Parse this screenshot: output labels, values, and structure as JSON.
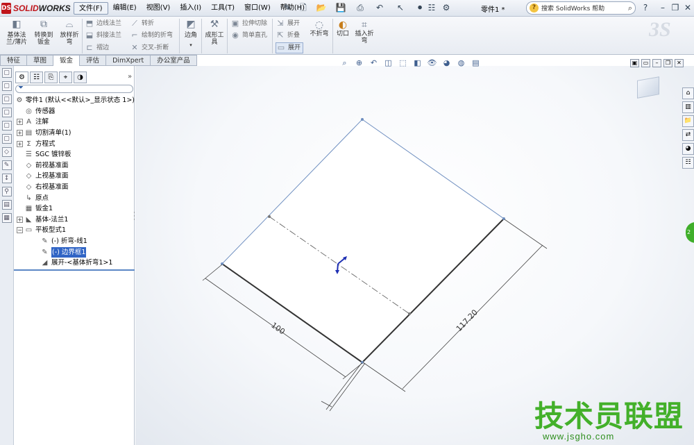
{
  "app": {
    "logo_prefix": "SOLID",
    "logo_suffix": "WORKS",
    "doc_title": "零件1 *"
  },
  "menu": [
    "文件(F)",
    "编辑(E)",
    "视图(V)",
    "插入(I)",
    "工具(T)",
    "窗口(W)",
    "帮助(H)"
  ],
  "help_search": {
    "placeholder": "搜索 SolidWorks 帮助"
  },
  "commands": {
    "base_flange": "基体法\n兰/薄片",
    "convert_to_sheet": "转换到\n钣金",
    "lofted_bend": "放样折\n弯",
    "edge_flange": "边线法兰",
    "miter_flange": "斜接法兰",
    "hem": "褶边",
    "jog": "转折",
    "sketched_bend": "绘制的折弯",
    "cross_break": "交叉-折断",
    "corners": "边角",
    "forming_tool": "成形工\n具",
    "extruded_cut": "拉伸切除",
    "simple_hole": "简单直孔",
    "unfold": "展开",
    "fold": "折叠",
    "flatten": "展开",
    "no_bends": "不折弯",
    "rip": "切口",
    "insert_bends": "插入折\n弯"
  },
  "tabs": [
    "特征",
    "草图",
    "钣金",
    "评估",
    "DimXpert",
    "办公室产品"
  ],
  "active_tab": "钣金",
  "tree": {
    "root": "零件1  (默认<<默认>_显示状态 1>)",
    "items": [
      {
        "label": "传感器",
        "icon": "sensor-icon",
        "expandable": false,
        "indent": 1
      },
      {
        "label": "注解",
        "icon": "annotation-icon",
        "expandable": true,
        "indent": 1
      },
      {
        "label": "切割清单(1)",
        "icon": "cutlist-icon",
        "expandable": true,
        "indent": 1
      },
      {
        "label": "方程式",
        "icon": "equation-icon",
        "expandable": true,
        "indent": 1
      },
      {
        "label": "SGC 镀锌板",
        "icon": "material-icon",
        "expandable": false,
        "indent": 1
      },
      {
        "label": "前视基准面",
        "icon": "plane-icon",
        "expandable": false,
        "indent": 1
      },
      {
        "label": "上视基准面",
        "icon": "plane-icon",
        "expandable": false,
        "indent": 1
      },
      {
        "label": "右视基准面",
        "icon": "plane-icon",
        "expandable": false,
        "indent": 1
      },
      {
        "label": "原点",
        "icon": "origin-icon",
        "expandable": false,
        "indent": 1
      },
      {
        "label": "钣金1",
        "icon": "sheetmetal-icon",
        "expandable": false,
        "indent": 1
      },
      {
        "label": "基体-法兰1",
        "icon": "flange-icon",
        "expandable": true,
        "indent": 1
      },
      {
        "label": "平板型式1",
        "icon": "flatpattern-icon",
        "expandable": true,
        "expanded": true,
        "indent": 1
      },
      {
        "label": "(-) 折弯-线1",
        "icon": "sketch-icon",
        "expandable": false,
        "indent": 2
      },
      {
        "label": "(-) 边界框1",
        "icon": "sketch-icon",
        "expandable": false,
        "indent": 2,
        "selected": true
      },
      {
        "label": "展开-<基体折弯1>1",
        "icon": "bend-icon",
        "expandable": false,
        "indent": 2
      }
    ]
  },
  "dimensions": {
    "short_edge": "100",
    "long_edge": "117.20"
  },
  "watermark": {
    "text": "技术员联盟",
    "url": "www.jsgho.com"
  },
  "colors": {
    "accent": "#3165c5",
    "watermark": "#43b02a",
    "brand_red": "#c0151b"
  }
}
